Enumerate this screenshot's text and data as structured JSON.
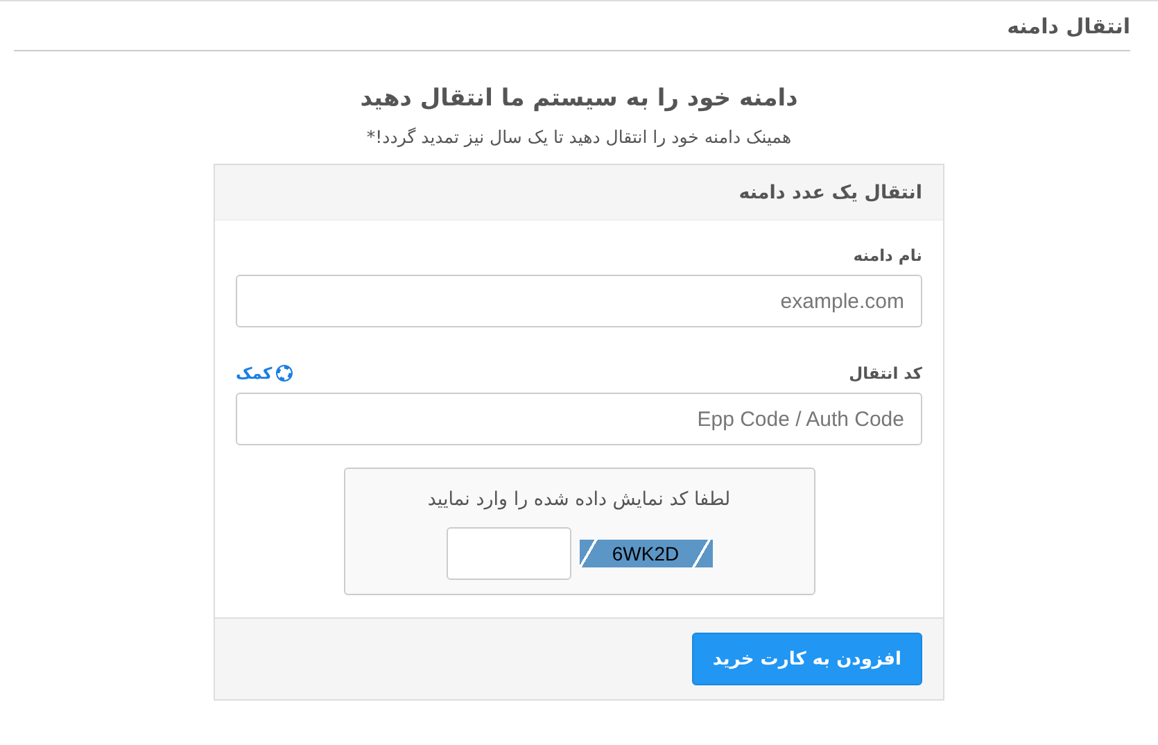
{
  "page_title": "انتقال دامنه",
  "heading": "دامنه خود را به سیستم ما انتقال دهید",
  "subheading": "همینک دامنه خود را انتقال دهید تا یک سال نیز تمدید گردد!*",
  "card": {
    "title": "انتقال یک عدد دامنه",
    "fields": [
      {
        "label": "نام دامنه",
        "placeholder": "example.com"
      },
      {
        "label": "کد انتقال",
        "placeholder": "Epp Code / Auth Code",
        "help": "کمک"
      }
    ],
    "captcha": {
      "prompt": "لطفا کد نمایش داده شده را وارد نمایید",
      "code": "6WK2D"
    },
    "submit": "افزودن به کارت خرید"
  }
}
